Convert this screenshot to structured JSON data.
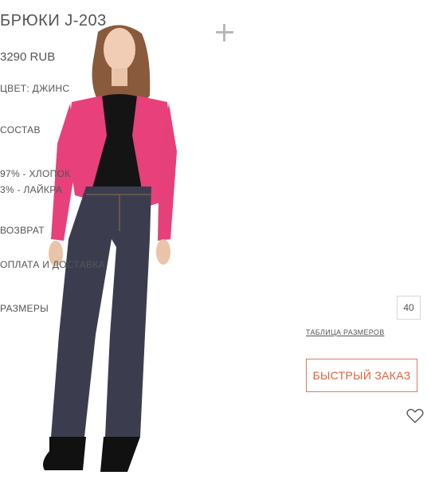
{
  "product": {
    "title": "БРЮКИ J-203",
    "price": "3290 RUB",
    "color_line": "ЦВЕТ: ДЖИНС"
  },
  "sections": {
    "composition": {
      "heading": "СОСТАВ",
      "lines": [
        "97% - ХЛОПОК",
        "3% - ЛАЙКРА"
      ]
    },
    "return_heading": "ВОЗВРАТ",
    "payment_heading": "ОПЛАТА И ДОСТАВКА"
  },
  "sizes": {
    "label": "РАЗМЕРЫ",
    "options": [
      "40"
    ],
    "table_link": "ТАБЛИЦА РАЗМЕРОВ"
  },
  "actions": {
    "quick_order_label": "БЫСТРЫЙ ЗАКАЗ"
  },
  "icons": {
    "zoom": "plus-icon",
    "wishlist": "heart-icon"
  },
  "colors": {
    "accent": "#e0603c",
    "cardigan": "#e8407a",
    "jeans": "#3b3d4f",
    "text": "#555555"
  }
}
